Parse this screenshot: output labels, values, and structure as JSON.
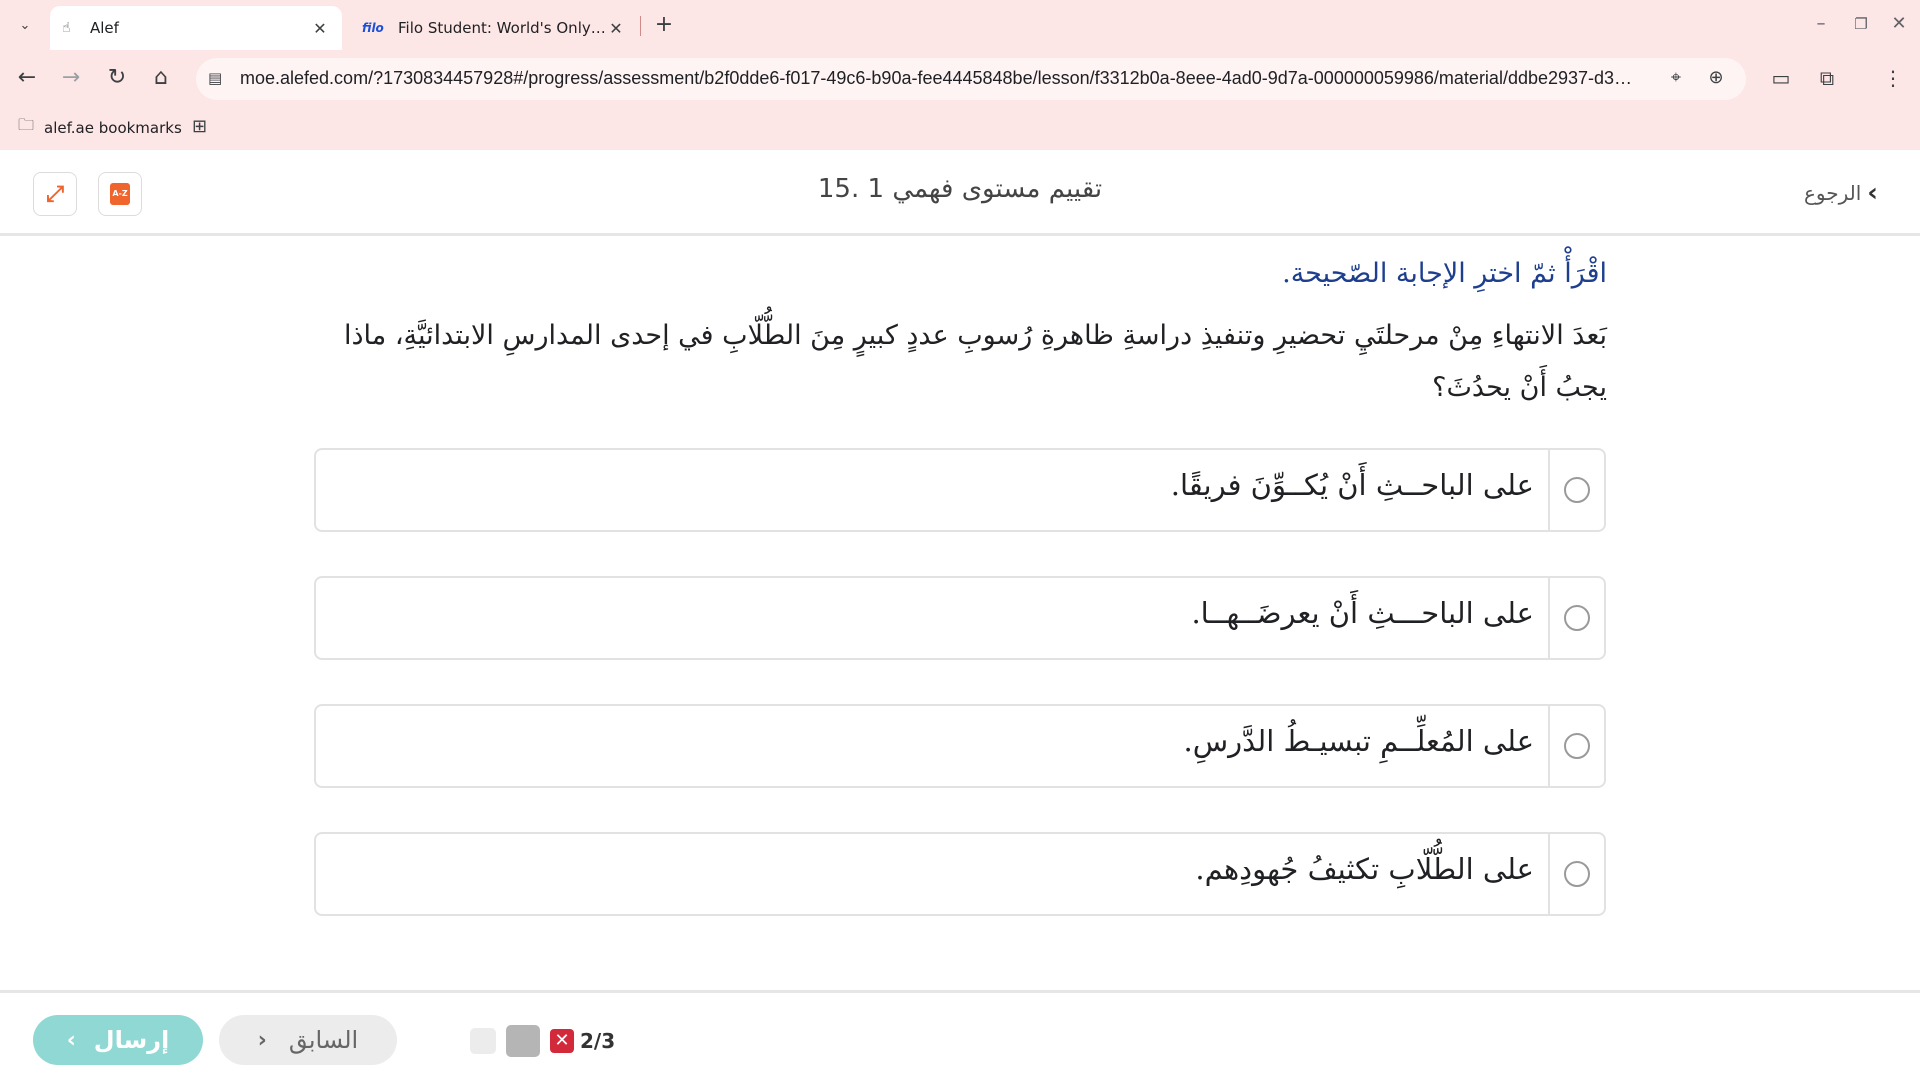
{
  "browser": {
    "tabs": [
      {
        "title": "Alef",
        "active": true
      },
      {
        "title": "Filo Student: World's Only Live I",
        "favicon_text": "filo",
        "active": false
      }
    ],
    "address_url": "moe.alefed.com/?1730834457928#/progress/assessment/b2f0dde6-f017-49c6-b90a-fee4445848be/lesson/f3312b0a-8eee-4ad0-9d7a-000000059986/material/ddbe2937-d388-4...",
    "bookmarks": [
      {
        "label": "alef.ae bookmarks"
      }
    ]
  },
  "header": {
    "title": "15. تقييم مستوى فهمي 1",
    "back_label": "الرجوع",
    "dictionary_icon_text": "A-Z"
  },
  "question": {
    "instruction": "اقْرَأْ ثمّ اخترِ الإجابة الصّحيحة.",
    "text": "بَعدَ الانتهاءِ مِنْ مرحلتَيِ تحضيرِ وتنفيذِ دراسةِ ظاهرةِ رُسوبِ عددٍ كبيرٍ مِنَ الطُّلّابِ في إحدى المدارسِ الابتدائيَّةِ، ماذا يجبُ أَنْ يحدُثَ؟",
    "options": [
      {
        "text": "على الباحــثِ أَنْ يُكــوِّنَ فريقًا."
      },
      {
        "text": "على الباحـــثِ أَنْ يعرضَــهــا."
      },
      {
        "text": "على المُعلِّــمِ تبسيـطُ الدَّرسِ."
      },
      {
        "text": "على الطُّلّابِ تكثيفُ جُهودِهم."
      }
    ]
  },
  "footer": {
    "send_label": "إرسال",
    "prev_label": "السابق",
    "progress_text": "2/3",
    "wrong_mark": "✕"
  },
  "colors": {
    "chrome_bg": "#fde6e6",
    "accent_orange": "#f0642d",
    "instruction_blue": "#1d3f8e",
    "send_teal": "#8fd8d3",
    "wrong_red": "#d22a3a"
  }
}
